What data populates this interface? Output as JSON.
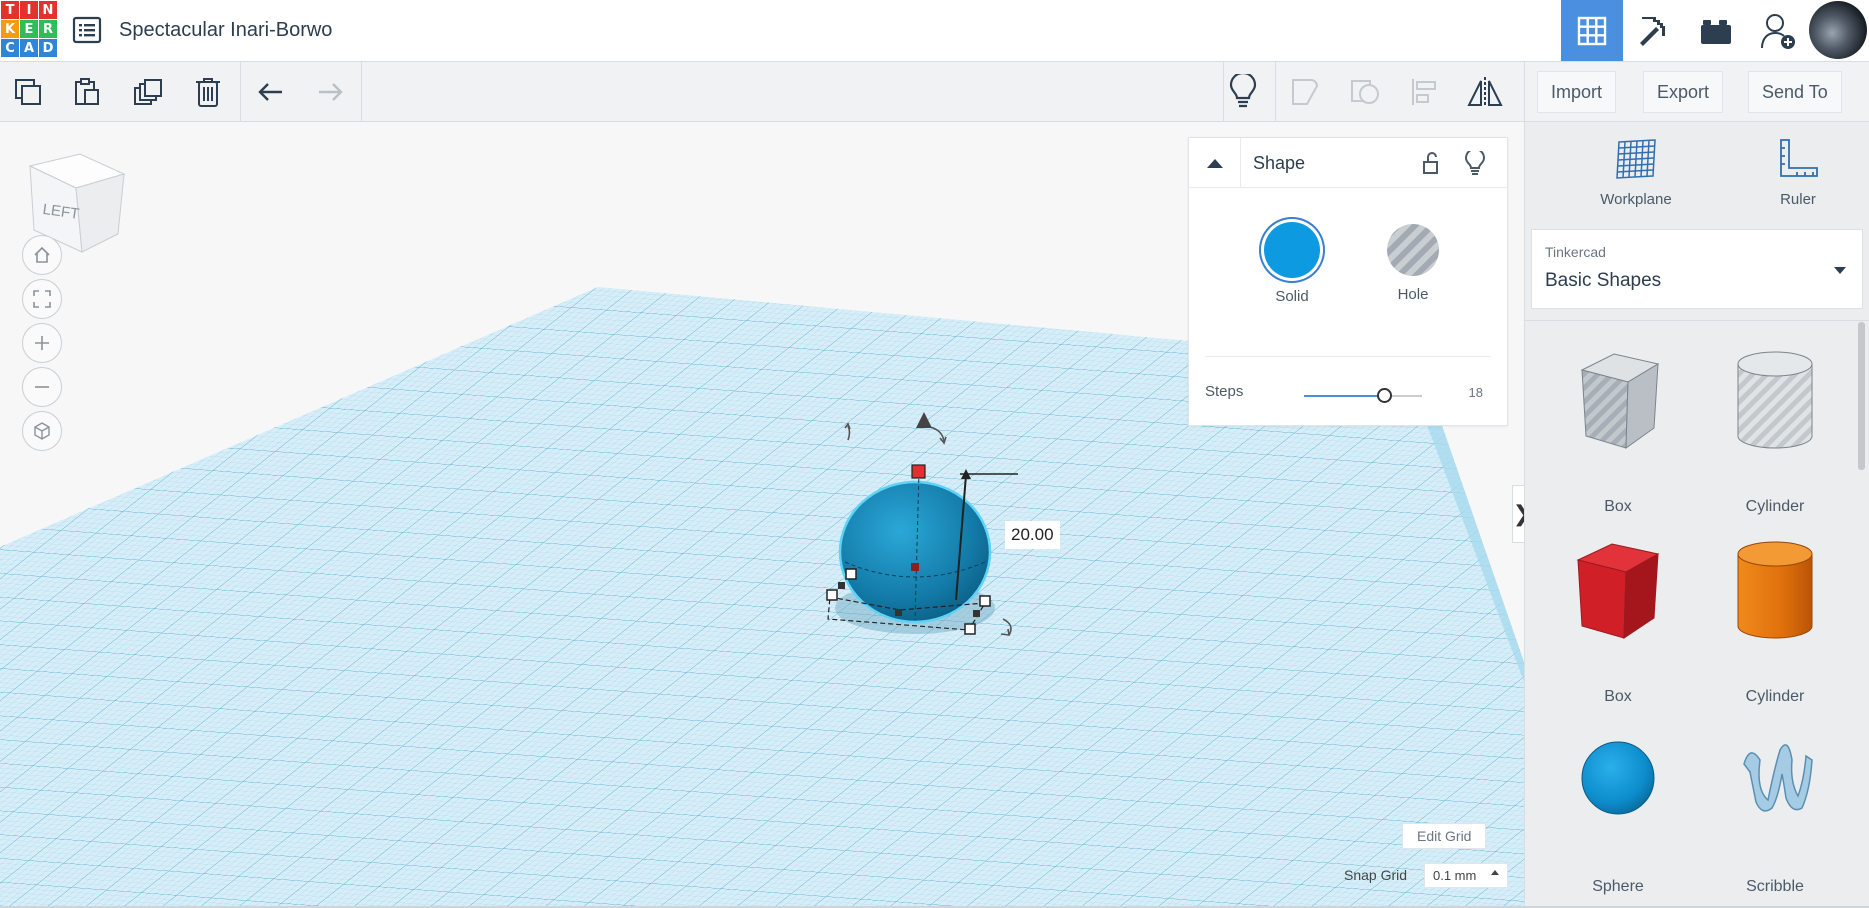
{
  "app": {
    "logo_letters": [
      "T",
      "I",
      "N",
      "K",
      "E",
      "R",
      "C",
      "A",
      "D"
    ],
    "logo_colors": [
      "#e2322b",
      "#e2322b",
      "#e2322b",
      "#f39c12",
      "#2ebd59",
      "#2ebd59",
      "#2f86d6",
      "#2f86d6",
      "#2f86d6"
    ],
    "design_title": "Spectacular Inari-Borwo"
  },
  "topbar": {
    "buttons": [
      {
        "name": "3d-design-view",
        "icon": "grid-icon",
        "active": true
      },
      {
        "name": "codeblocks",
        "icon": "pickaxe-icon",
        "active": false
      },
      {
        "name": "bricks",
        "icon": "brick-icon",
        "active": false
      },
      {
        "name": "invite-user",
        "icon": "add-user-icon",
        "active": false
      }
    ]
  },
  "toolbar": {
    "left_icons": [
      "copy-icon",
      "paste-icon",
      "duplicate-icon",
      "trash-icon",
      "undo-icon",
      "redo-icon"
    ],
    "right_icons": [
      "lightbulb-icon",
      "group-icon",
      "ungroup-icon",
      "align-icon",
      "mirror-icon"
    ],
    "import_label": "Import",
    "export_label": "Export",
    "send_to_label": "Send To"
  },
  "viewport": {
    "view_cube_face": "LEFT",
    "nav_icons": [
      "home-icon",
      "fit-view-icon",
      "zoom-in-icon",
      "zoom-out-icon",
      "projection-icon"
    ],
    "dimension_value": "20.00",
    "edit_grid_label": "Edit Grid",
    "snap_grid_label": "Snap Grid",
    "snap_grid_value": "0.1 mm",
    "collapse_glyph": "❯",
    "grid_color": "#5fb6d8",
    "shape_color": "#1d8fbf"
  },
  "inspector": {
    "title": "Shape",
    "solid_label": "Solid",
    "hole_label": "Hole",
    "solid_color": "#0d9ae0",
    "steps_label": "Steps",
    "steps_value": "18",
    "steps_fraction": 0.68
  },
  "right_panel": {
    "workplane_label": "Workplane",
    "ruler_label": "Ruler",
    "library_source": "Tinkercad",
    "library_name": "Basic Shapes",
    "shapes": [
      {
        "label": "Box",
        "kind": "box-hole"
      },
      {
        "label": "Cylinder",
        "kind": "cylinder-hole"
      },
      {
        "label": "Box",
        "kind": "box-red"
      },
      {
        "label": "Cylinder",
        "kind": "cylinder-orange"
      },
      {
        "label": "Sphere",
        "kind": "sphere-blue"
      },
      {
        "label": "Scribble",
        "kind": "scribble"
      }
    ]
  }
}
